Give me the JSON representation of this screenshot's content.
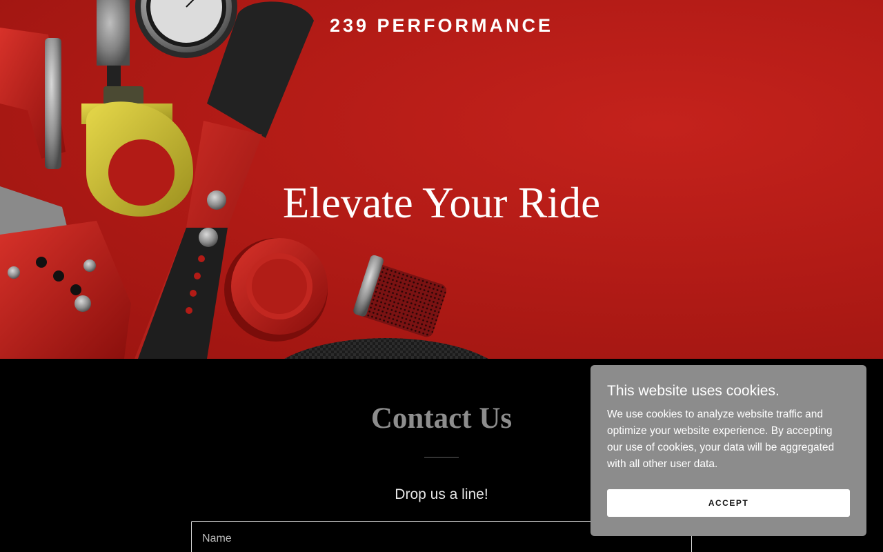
{
  "site": {
    "title": "239 PERFORMANCE"
  },
  "hero": {
    "headline": "Elevate Your Ride",
    "image_subject": "car-parts-on-red-background",
    "background_color": "#b21b16"
  },
  "contact": {
    "title": "Contact Us",
    "subtitle": "Drop us a line!",
    "name_placeholder": "Name"
  },
  "cookie_banner": {
    "title": "This website uses cookies.",
    "text": "We use cookies to analyze website traffic and optimize your website experience. By accepting our use of cookies, your data will be aggregated with all other user data.",
    "accept_label": "ACCEPT",
    "background_color": "#8c8c8c"
  }
}
